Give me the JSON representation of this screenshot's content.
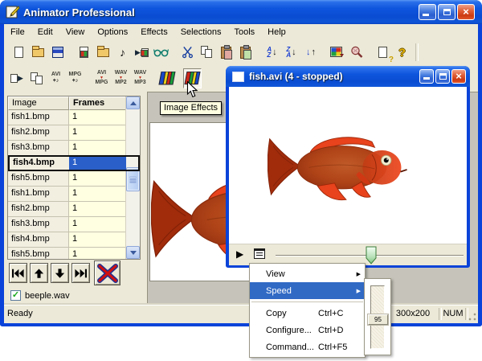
{
  "titlebar": {
    "title": "Animator Professional"
  },
  "menubar": {
    "items": [
      "File",
      "Edit",
      "View",
      "Options",
      "Effects",
      "Selections",
      "Tools",
      "Help"
    ]
  },
  "toolbar_main": {
    "icons": [
      "new-file",
      "open-folder",
      "save",
      "new-image",
      "new-image-folder",
      "audio-note",
      "play-frames",
      "preview-glasses",
      "cut",
      "copy",
      "paste-frame",
      "paste-image",
      "sort-az-descending",
      "sort-za-descending",
      "reverse-order",
      "image-palette",
      "zoom-magnifier",
      "context-help",
      "about-help"
    ]
  },
  "toolbar_anim": {
    "icons": [
      "play-animation",
      "build-animation",
      "avi-with-audio",
      "mpg-with-audio",
      "avi-to-mpg",
      "wav-to-mp2",
      "wav-to-mp3",
      "film-effects",
      "image-effects"
    ],
    "labels": {
      "avi": "AVI",
      "mpg": "MPG",
      "wav": "WAV",
      "mp2": "MP2",
      "mp3": "MP3",
      "plus_note": "+♪"
    }
  },
  "tooltip": {
    "text": "Image Effects"
  },
  "frame_table": {
    "headers": {
      "image": "Image",
      "frames": "Frames"
    },
    "rows": [
      {
        "image": "fish1.bmp",
        "frames": "1"
      },
      {
        "image": "fish2.bmp",
        "frames": "1"
      },
      {
        "image": "fish3.bmp",
        "frames": "1"
      },
      {
        "image": "fish4.bmp",
        "frames": "1",
        "selected": true
      },
      {
        "image": "fish5.bmp",
        "frames": "1"
      },
      {
        "image": "fish1.bmp",
        "frames": "1"
      },
      {
        "image": "fish2.bmp",
        "frames": "1"
      },
      {
        "image": "fish3.bmp",
        "frames": "1"
      },
      {
        "image": "fish4.bmp",
        "frames": "1"
      },
      {
        "image": "fish5.bmp",
        "frames": "1"
      }
    ]
  },
  "audio_track": {
    "label": "beeple.wav",
    "checked": true
  },
  "child_window": {
    "title": "fish.avi (4 - stopped)"
  },
  "context_menu": {
    "items": [
      {
        "label": "View",
        "has_submenu": true
      },
      {
        "label": "Speed",
        "has_submenu": true,
        "highlighted": true
      },
      {
        "label": "Copy",
        "shortcut": "Ctrl+C"
      },
      {
        "label": "Configure...",
        "shortcut": "Ctrl+D"
      },
      {
        "label": "Command...",
        "shortcut": "Ctrl+F5"
      }
    ]
  },
  "speed_slider": {
    "value": "95"
  },
  "statusbar": {
    "message": "Ready",
    "dimensions": "300x200",
    "keyboard": "NUM"
  },
  "icons": {
    "close": "×",
    "play": "▶",
    "note": "♪",
    "check": "✓",
    "submenu_arrow": "▶",
    "down_arrow": "↓",
    "up_arrow": "↑",
    "help": "?",
    "letter_a": "A",
    "letter_z": "Z",
    "red_down": "▼"
  },
  "colors": {
    "titlebar_top": "#5a96f2",
    "titlebar_bottom": "#0a4cd2",
    "window_border": "#0a43d9",
    "chrome": "#ece9d8",
    "canvas": "#c6c4ba",
    "selection": "#2a5fc9",
    "menu_highlight": "#316ac5",
    "tooltip_bg": "#ffffe1",
    "frames_cell": "#ffffe1"
  }
}
